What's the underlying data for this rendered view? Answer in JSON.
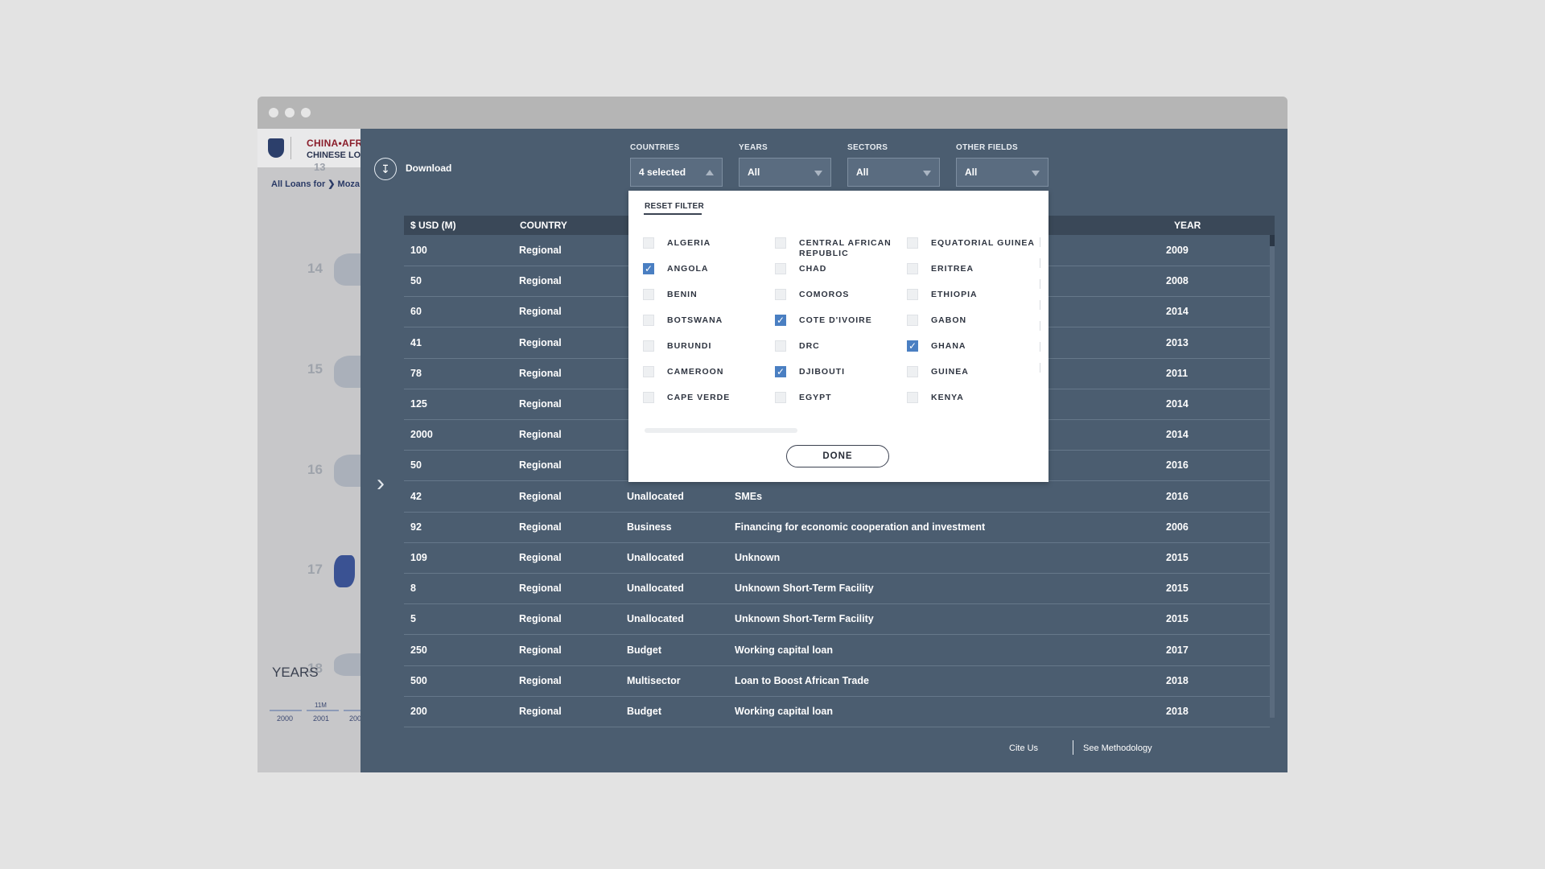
{
  "left_app": {
    "brand_line1": "CHINA•AFR",
    "brand_line2": "CHINESE LO",
    "breadcrumb": "All Loans for ❯ Moza",
    "partial_number": "13",
    "year_numbers": [
      "14",
      "15",
      "16",
      "17",
      "18"
    ],
    "years_title": "YEARS",
    "year_ticks": [
      "2000",
      "2001",
      "200"
    ],
    "tick_note": "11M"
  },
  "panel": {
    "download_label": "Download",
    "filters": [
      {
        "label": "COUNTRIES",
        "value": "4 selected",
        "open": true
      },
      {
        "label": "YEARS",
        "value": "All",
        "open": false
      },
      {
        "label": "SECTORS",
        "value": "All",
        "open": false
      },
      {
        "label": "OTHER FIELDS",
        "value": "All",
        "open": false
      }
    ],
    "table": {
      "headers": {
        "usd": "$ USD (M)",
        "country": "COUNTRY",
        "year": "YEAR"
      },
      "rows": [
        {
          "usd": "100",
          "country": "Regional",
          "sector": "",
          "description": "",
          "year": "2009"
        },
        {
          "usd": "50",
          "country": "Regional",
          "sector": "",
          "description": "",
          "year": "2008"
        },
        {
          "usd": "60",
          "country": "Regional",
          "sector": "",
          "description": "",
          "year": "2014"
        },
        {
          "usd": "41",
          "country": "Regional",
          "sector": "",
          "description": "",
          "year": "2013"
        },
        {
          "usd": "78",
          "country": "Regional",
          "sector": "",
          "description": "",
          "year": "2011"
        },
        {
          "usd": "125",
          "country": "Regional",
          "sector": "",
          "description": "",
          "year": "2014"
        },
        {
          "usd": "2000",
          "country": "Regional",
          "sector": "",
          "description": "",
          "year": "2014"
        },
        {
          "usd": "50",
          "country": "Regional",
          "sector": "",
          "description": "",
          "year": "2016"
        },
        {
          "usd": "42",
          "country": "Regional",
          "sector": "Unallocated",
          "description": "SMEs",
          "year": "2016"
        },
        {
          "usd": "92",
          "country": "Regional",
          "sector": "Business",
          "description": "Financing for economic cooperation and investment",
          "year": "2006"
        },
        {
          "usd": "109",
          "country": "Regional",
          "sector": "Unallocated",
          "description": "Unknown",
          "year": "2015"
        },
        {
          "usd": "8",
          "country": "Regional",
          "sector": "Unallocated",
          "description": "Unknown Short-Term Facility",
          "year": "2015"
        },
        {
          "usd": "5",
          "country": "Regional",
          "sector": "Unallocated",
          "description": "Unknown Short-Term Facility",
          "year": "2015"
        },
        {
          "usd": "250",
          "country": "Regional",
          "sector": "Budget",
          "description": "Working capital loan",
          "year": "2017"
        },
        {
          "usd": "500",
          "country": "Regional",
          "sector": "Multisector",
          "description": "Loan to Boost African Trade",
          "year": "2018"
        },
        {
          "usd": "200",
          "country": "Regional",
          "sector": "Budget",
          "description": "Working capital loan",
          "year": "2018"
        }
      ]
    },
    "footer": {
      "cite": "Cite Us",
      "methodology": "See Methodology"
    }
  },
  "dropdown": {
    "reset_label": "RESET FILTER",
    "done_label": "DONE",
    "columns": [
      [
        {
          "label": "ALGERIA",
          "checked": false
        },
        {
          "label": "ANGOLA",
          "checked": true
        },
        {
          "label": "BENIN",
          "checked": false
        },
        {
          "label": "BOTSWANA",
          "checked": false
        },
        {
          "label": "BURUNDI",
          "checked": false
        },
        {
          "label": "CAMEROON",
          "checked": false
        },
        {
          "label": "CAPE VERDE",
          "checked": false
        }
      ],
      [
        {
          "label": "CENTRAL AFRICAN REPUBLIC",
          "checked": false
        },
        {
          "label": "CHAD",
          "checked": false
        },
        {
          "label": "COMOROS",
          "checked": false
        },
        {
          "label": "COTE D'IVOIRE",
          "checked": true
        },
        {
          "label": "DRC",
          "checked": false
        },
        {
          "label": "DJIBOUTI",
          "checked": true
        },
        {
          "label": "EGYPT",
          "checked": false
        }
      ],
      [
        {
          "label": "EQUATORIAL GUINEA",
          "checked": false
        },
        {
          "label": "ERITREA",
          "checked": false
        },
        {
          "label": "ETHIOPIA",
          "checked": false
        },
        {
          "label": "GABON",
          "checked": false
        },
        {
          "label": "GHANA",
          "checked": true
        },
        {
          "label": "GUINEA",
          "checked": false
        },
        {
          "label": "KENYA",
          "checked": false
        }
      ]
    ]
  },
  "colors": {
    "panel": "#4b5d70",
    "header_row": "#3a4858",
    "checkbox_checked": "#4a7fc2",
    "brand_red": "#8a1d2a",
    "brand_navy": "#2a3450"
  }
}
